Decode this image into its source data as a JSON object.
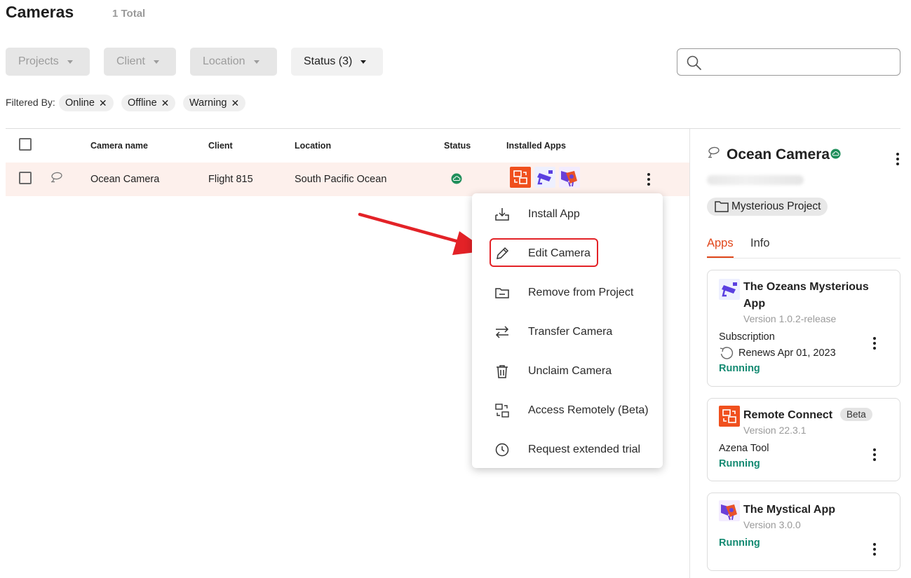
{
  "header": {
    "title": "Cameras",
    "total": "1 Total"
  },
  "filters": {
    "buttons": [
      {
        "label": "Projects"
      },
      {
        "label": "Client"
      },
      {
        "label": "Location"
      },
      {
        "label": "Status (3)"
      }
    ],
    "search_placeholder": "",
    "filtered_by_label": "Filtered By:",
    "chips": [
      "Online",
      "Offline",
      "Warning"
    ]
  },
  "table": {
    "columns": [
      "Camera name",
      "Client",
      "Location",
      "Status",
      "Installed Apps"
    ],
    "rows": [
      {
        "camera_name": "Ocean Camera",
        "client": "Flight 815",
        "location": "South Pacific Ocean",
        "status": "online"
      }
    ]
  },
  "context_menu": {
    "items": [
      {
        "label": "Install App",
        "icon": "install-icon"
      },
      {
        "label": "Edit Camera",
        "icon": "pencil-icon"
      },
      {
        "label": "Remove from Project",
        "icon": "folder-minus-icon"
      },
      {
        "label": "Transfer Camera",
        "icon": "transfer-icon"
      },
      {
        "label": "Unclaim Camera",
        "icon": "trash-icon"
      },
      {
        "label": "Access Remotely (Beta)",
        "icon": "remote-access-icon"
      },
      {
        "label": "Request extended trial",
        "icon": "clock-icon"
      }
    ]
  },
  "panel": {
    "camera_title": "Ocean Camera",
    "project": "Mysterious Project",
    "tabs": [
      "Apps",
      "Info"
    ],
    "apps": [
      {
        "name_line1": "The Ozeans Mysterious",
        "name_line2": "App",
        "version": "Version 1.0.2-release",
        "subscription_label": "Subscription",
        "renews": "Renews Apr 01, 2023",
        "status": "Running"
      },
      {
        "name": "Remote Connect",
        "badge": "Beta",
        "version": "Version 22.3.1",
        "tool": "Azena Tool",
        "status": "Running"
      },
      {
        "name": "The Mystical App",
        "version": "Version 3.0.0",
        "status": "Running"
      }
    ]
  },
  "colors": {
    "accent": "#e0461a",
    "running": "#148a72",
    "online": "#1e8e5a",
    "row_highlight": "#fdf0ec",
    "annotation_red": "#e32227"
  }
}
